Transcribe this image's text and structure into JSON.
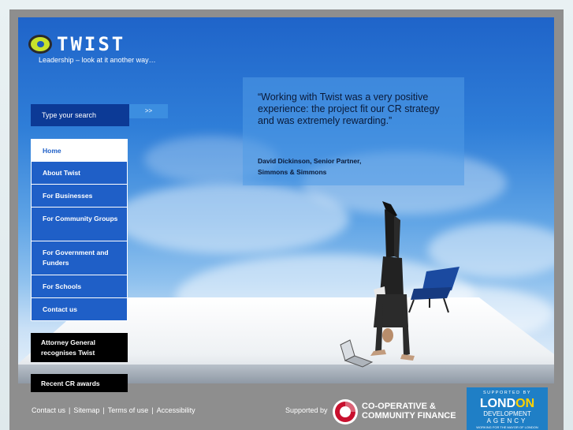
{
  "brand": {
    "name": "TWIST",
    "tagline": "Leadership – look at it another way…",
    "logo_colors": {
      "ring": "#c8e22b",
      "core": "#1e5bb8"
    }
  },
  "search": {
    "placeholder": "Type your search",
    "button_label": ">>"
  },
  "nav": {
    "items": [
      {
        "label": "Home",
        "active": true
      },
      {
        "label": "About Twist"
      },
      {
        "label": "For Businesses"
      },
      {
        "label": "For Community Groups"
      },
      {
        "label": "For Government and Funders"
      },
      {
        "label": "For Schools"
      },
      {
        "label": "Contact us"
      }
    ]
  },
  "news": [
    {
      "label": "Attorney General recognises Twist"
    },
    {
      "label": "Recent CR awards"
    }
  ],
  "quote": {
    "text": "“Working with Twist was a very positive experience: the project fit our CR strategy and was extremely rewarding.”",
    "author_line1": "David Dickinson, Senior Partner,",
    "author_line2": "Simmons & Simmons"
  },
  "footer": {
    "links": [
      "Contact us",
      "Sitemap",
      "Terms of use",
      "Accessibility"
    ],
    "separator": "|",
    "supported_by": "Supported by",
    "coop_line1": "CO-OPERATIVE &",
    "coop_line2": "COMMUNITY FINANCE",
    "lda": {
      "supported": "SUPPORTED BY",
      "london_a": "LOND",
      "london_b": "ON",
      "development": "DEVELOPMENT",
      "agency": "AGENCY",
      "mayor": "WORKING FOR THE MAYOR OF LONDON"
    }
  },
  "colors": {
    "nav_bg": "#1f5fc7",
    "search_bg": "#0c3a96",
    "search_btn": "#3c8ee0",
    "news_bg": "#000000",
    "lda_bg": "#1f7fc6",
    "lda_accent": "#ffd200"
  }
}
